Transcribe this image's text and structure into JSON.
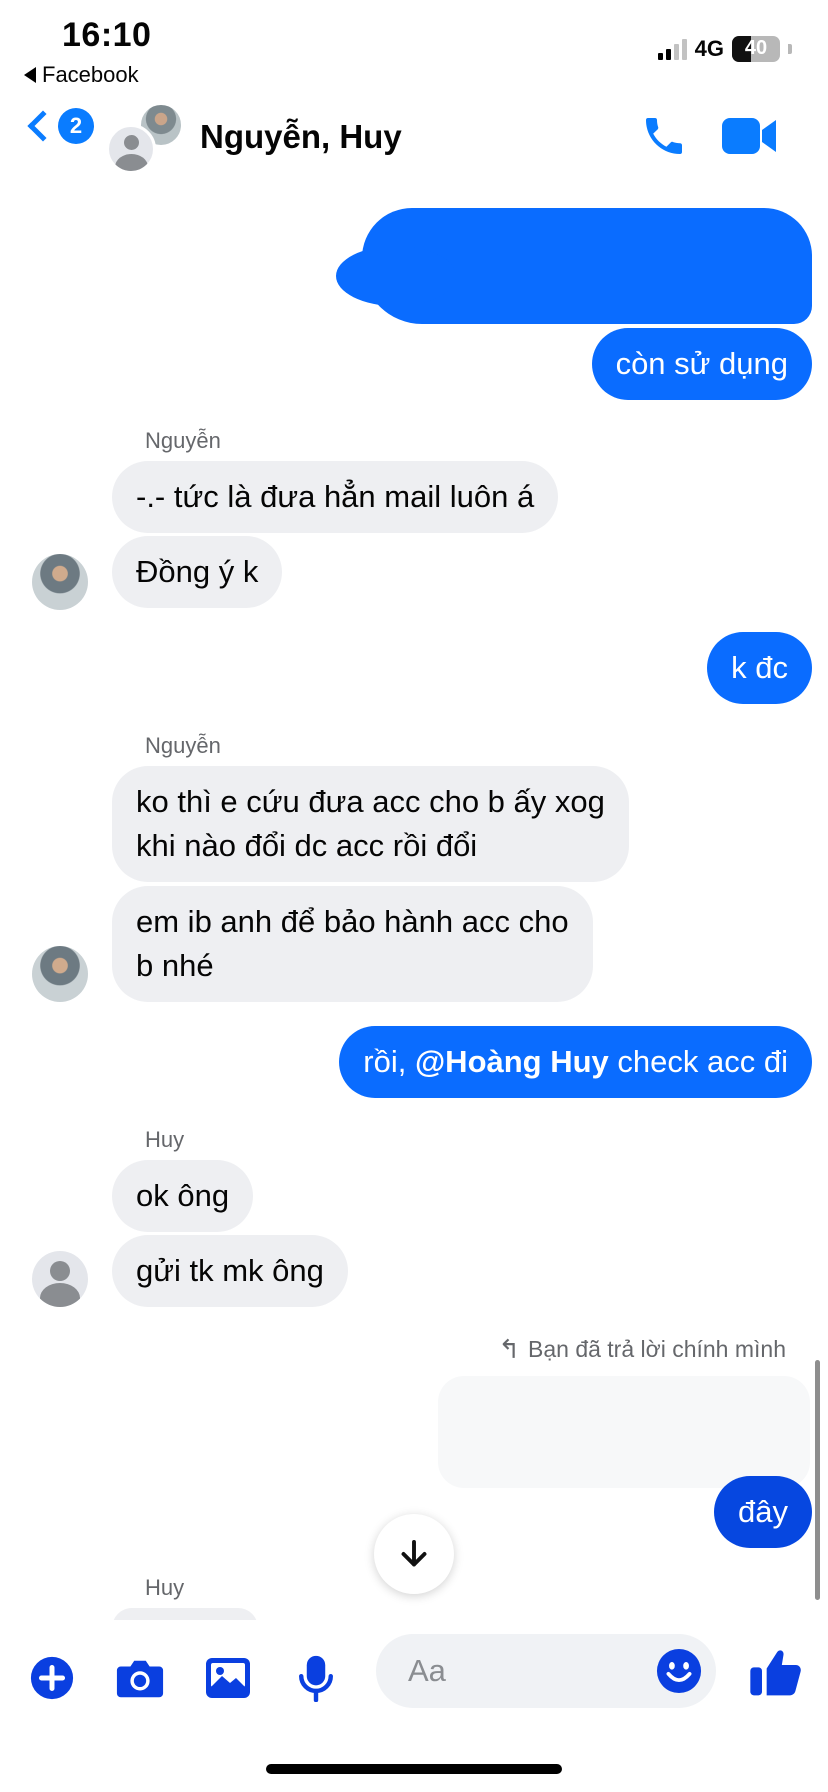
{
  "status_bar": {
    "time": "16:10",
    "back_app": "Facebook",
    "network": "4G",
    "battery_level": "40"
  },
  "header": {
    "unread_count": "2",
    "title": "Nguyễn, Huy",
    "accent_color": "#0a7cff"
  },
  "messages": {
    "m1": "còn sử dụng",
    "sender_a": "Nguyễn",
    "m2": "-.- tức là đưa hẳn mail luôn á",
    "m3": "Đồng ý k",
    "m4": "k đc",
    "sender_b": "Nguyễn",
    "m5_line1": "ko thì e cứu đưa acc cho b ấy xog",
    "m5_line2": "khi nào đổi dc acc rồi đổi",
    "m6_line1": "em ib anh để bảo hành acc cho",
    "m6_line2": "b nhé",
    "m7_prefix": "rồi, ",
    "m7_mention": "@Hoàng Huy",
    "m7_suffix": " check acc đi",
    "sender_c": "Huy",
    "m8": "ok ông",
    "m9": "gửi tk mk ông",
    "reply_note": "Bạn đã trả lời chính mình",
    "m10": "đây",
    "sender_d": "Huy"
  },
  "composer": {
    "placeholder": "Aa"
  },
  "icons": {
    "add": "plus-circle-icon",
    "camera": "camera-icon",
    "gallery": "image-icon",
    "voice": "microphone-icon",
    "emoji": "emoji-icon",
    "like": "thumbs-up-icon"
  }
}
